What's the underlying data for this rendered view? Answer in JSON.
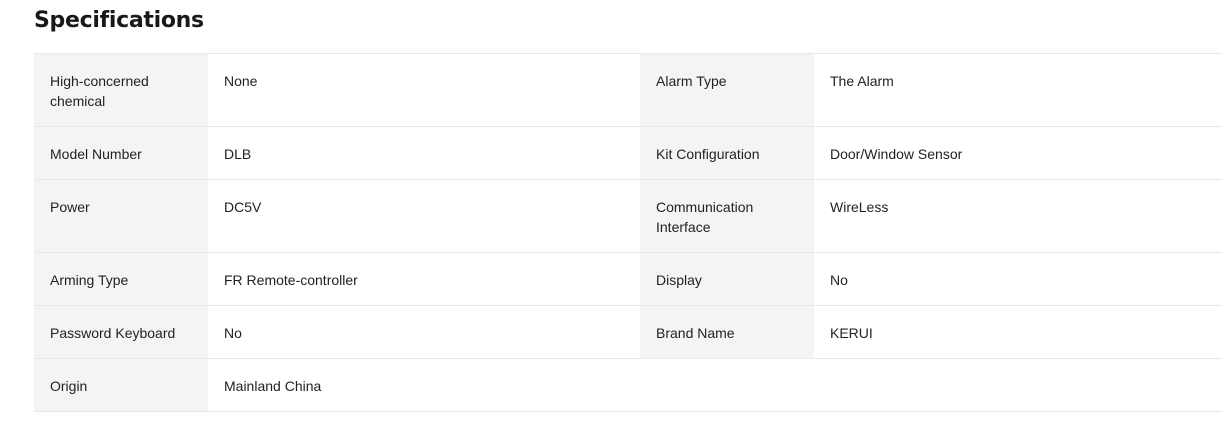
{
  "section": {
    "title": "Specifications"
  },
  "specs": [
    {
      "k1": "High-concerned chemical",
      "v1": "None",
      "k2": "Alarm Type",
      "v2": "The Alarm"
    },
    {
      "k1": "Model Number",
      "v1": "DLB",
      "k2": "Kit Configuration",
      "v2": "Door/Window Sensor"
    },
    {
      "k1": "Power",
      "v1": "DC5V",
      "k2": "Communication Interface",
      "v2": "WireLess"
    },
    {
      "k1": "Arming Type",
      "v1": "FR Remote-controller",
      "k2": "Display",
      "v2": "No"
    },
    {
      "k1": "Password Keyboard",
      "v1": "No",
      "k2": "Brand Name",
      "v2": "KERUI"
    },
    {
      "k1": "Origin",
      "v1": "Mainland China"
    }
  ]
}
